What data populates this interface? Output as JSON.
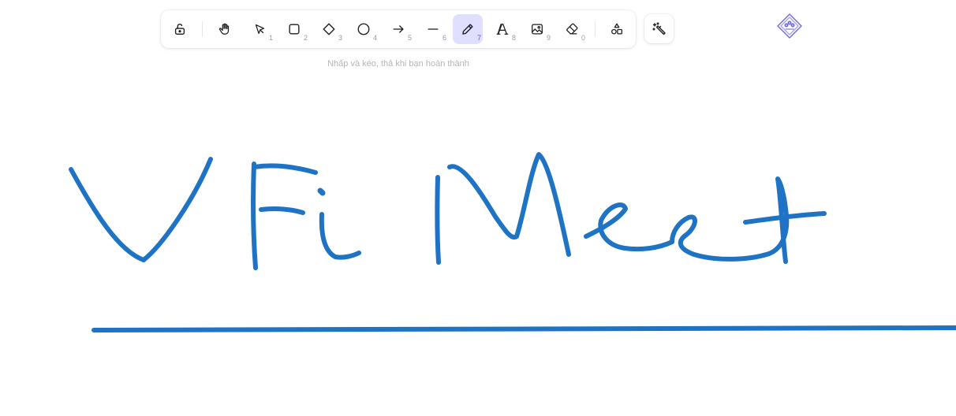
{
  "toolbar": {
    "tools": [
      {
        "name": "lock",
        "icon": "lock-open-icon",
        "key": ""
      },
      {
        "name": "hand",
        "icon": "hand-icon",
        "key": ""
      },
      {
        "name": "selection",
        "icon": "cursor-arrow-icon",
        "key": "1"
      },
      {
        "name": "rectangle",
        "icon": "square-icon",
        "key": "2"
      },
      {
        "name": "diamond",
        "icon": "diamond-icon",
        "key": "3"
      },
      {
        "name": "ellipse",
        "icon": "circle-icon",
        "key": "4"
      },
      {
        "name": "arrow",
        "icon": "arrow-right-icon",
        "key": "5"
      },
      {
        "name": "line",
        "icon": "line-icon",
        "key": "6"
      },
      {
        "name": "draw",
        "icon": "pencil-icon",
        "key": "7",
        "active": true
      },
      {
        "name": "text",
        "icon": "text-a-icon",
        "key": "8"
      },
      {
        "name": "image",
        "icon": "image-icon",
        "key": "9"
      },
      {
        "name": "eraser",
        "icon": "eraser-icon",
        "key": "0"
      },
      {
        "name": "extra-tools",
        "icon": "shapes-icon",
        "key": ""
      }
    ],
    "magic_icon": "magic-wand-icon",
    "library_icon": "library-icon"
  },
  "hint": {
    "text": "Nhấp và kéo, thả khi bạn hoàn thành"
  },
  "colors": {
    "stroke": "#1f73c4",
    "active_tool_bg": "#e0dfff",
    "accent": "#6965db",
    "hint_text": "#b4b4bb"
  }
}
